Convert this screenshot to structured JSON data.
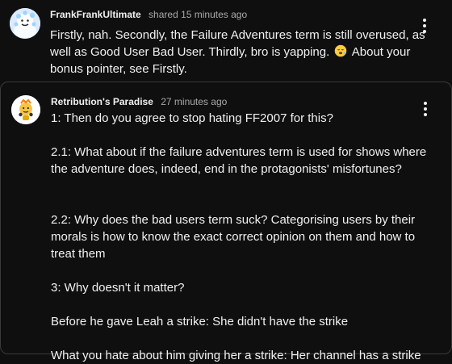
{
  "comments": [
    {
      "author": "FrankFrankUltimate",
      "time": "shared 15 minutes ago",
      "text_part1": "Firstly, nah. Secondly, the Failure Adventures term is still overused, as well as Good User Bad User. Thirdly, bro is yapping. ",
      "text_part2": " About your bonus pointer, see Firstly.",
      "avatar_icon": "ice-cream-avatar",
      "emoji_icon": "sleepy-face-emoji",
      "menu_icon": "more-vert-icon"
    },
    {
      "author": "Retribution's Paradise",
      "time": "27 minutes ago",
      "text": "1: Then do you agree to stop hating FF2007 for this?\n\n2.1: What about if the failure adventures term is used for shows where the adventure does, indeed, end in the protagonists' misfortunes?\n\n\n2.2: Why does the bad users term suck? Categorising users by their morals is how to know the exact correct opinion on them and how to treat them\n\n3: Why doesn't it matter?\n\nBefore he gave Leah a strike: She didn't have the strike\n\nWhat you hate about him giving her a strike: Her channel has a strike",
      "avatar_icon": "yellow-character-avatar",
      "menu_icon": "more-vert-icon"
    }
  ],
  "colors": {
    "background": "#0f0f0f",
    "text": "#f1f1f1",
    "secondary_text": "#aaaaaa",
    "border": "#3a3a3a"
  }
}
